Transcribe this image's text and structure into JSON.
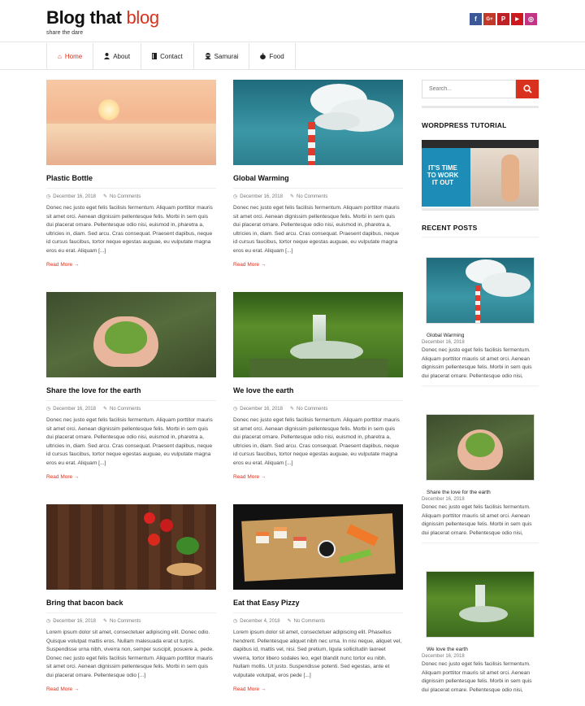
{
  "site": {
    "title_main": "Blog that",
    "title_accent": "blog",
    "tagline": "share the dare"
  },
  "socials": [
    {
      "name": "facebook",
      "glyph": "f",
      "color": "#3b5998"
    },
    {
      "name": "google-plus",
      "glyph": "G+",
      "color": "#c0392b"
    },
    {
      "name": "pinterest",
      "glyph": "P",
      "color": "#bd2126"
    },
    {
      "name": "youtube",
      "glyph": "▶",
      "color": "#cc181e"
    },
    {
      "name": "instagram",
      "glyph": "◎",
      "color": "#c13584"
    }
  ],
  "nav": {
    "items": [
      {
        "label": "Home",
        "icon": "home-icon"
      },
      {
        "label": "About",
        "icon": "user-icon"
      },
      {
        "label": "Contact",
        "icon": "book-icon"
      },
      {
        "label": "Samurai",
        "icon": "ninja-icon"
      },
      {
        "label": "Food",
        "icon": "apple-icon"
      }
    ]
  },
  "posts": [
    {
      "title": "Plastic Bottle",
      "date": "December 16, 2018",
      "comments": "No Comments",
      "excerpt": "Donec nec justo eget felis facilisis fermentum. Aliquam porttitor mauris sit amet orci. Aenean dignissim pellentesque felis. Morbi in sem quis dui placerat ornare. Pellentesque odio nisi, euismod in, pharetra a, ultricies in, diam. Sed arcu. Cras consequat. Praesent dapibus, neque id cursus faucibus, tortor neque egestas auguae, eu vulputate magna eros eu erat. Aliquam [...]",
      "read_more": "Read More →"
    },
    {
      "title": "Global Warming",
      "date": "December 16, 2018",
      "comments": "No Comments",
      "excerpt": "Donec nec justo eget felis facilisis fermentum. Aliquam porttitor mauris sit amet orci. Aenean dignissim pellentesque felis. Morbi in sem quis dui placerat ornare. Pellentesque odio nisi, euismod in, pharetra a, ultricies in, diam. Sed arcu. Cras consequat. Praesent dapibus, neque id cursus faucibus, tortor neque egestas auguae, eu vulputate magna eros eu erat. Aliquam [...]",
      "read_more": "Read More →"
    },
    {
      "title": "Share the love for the earth",
      "date": "December 16, 2018",
      "comments": "No Comments",
      "excerpt": "Donec nec justo eget felis facilisis fermentum. Aliquam porttitor mauris sit amet orci. Aenean dignissim pellentesque felis. Morbi in sem quis dui placerat ornare. Pellentesque odio nisi, euismod in, pharetra a, ultricies in, diam. Sed arcu. Cras consequat. Praesent dapibus, neque id cursus faucibus, tortor neque egestas auguae, eu vulputate magna eros eu erat. Aliquam [...]",
      "read_more": "Read More →"
    },
    {
      "title": "We love the earth",
      "date": "December 16, 2018",
      "comments": "No Comments",
      "excerpt": "Donec nec justo eget felis facilisis fermentum. Aliquam porttitor mauris sit amet orci. Aenean dignissim pellentesque felis. Morbi in sem quis dui placerat ornare. Pellentesque odio nisi, euismod in, pharetra a, ultricies in, diam. Sed arcu. Cras consequat. Praesent dapibus, neque id cursus faucibus, tortor neque egestas auguae, eu vulputate magna eros eu erat. Aliquam [...]",
      "read_more": "Read More →"
    },
    {
      "title": "Bring that bacon back",
      "date": "December 16, 2018",
      "comments": "No Comments",
      "excerpt": "Lorem ipsum dolor sit amet, consectetuer adipiscing elit. Donec odio. Quisque volutpat mattis eros. Nullam malesuada erat ut turpis. Suspendisse urna nibh, viverra non, semper suscipit, posuere a, pede. Donec nec justo eget felis facilisis fermentum. Aliquam porttitor mauris sit amet orci. Aenean dignissim pellentesque felis. Morbi in sem quis dui placerat ornare. Pellentesque odio [...]",
      "read_more": "Read More →"
    },
    {
      "title": "Eat that Easy Pizzy",
      "date": "December 4, 2018",
      "comments": "No Comments",
      "excerpt": "Lorem ipsum dolor sit amet, consectetuer adipiscing elit. Phasellus hendrerit. Pellentesque aliquet nibh nec urna. In nisi neque, aliquet vel, dapibus id, mattis vel, nisi. Sed pretium, ligula sollicitudin laoreet viverra, tortor libero sodales leo, eget blandit nunc tortor eu nibh. Nullam mollis. Ut justo. Suspendisse potenti. Sed egestas, ante et vulputate volutpat, eros pede [...]",
      "read_more": "Read More →"
    }
  ],
  "sidebar": {
    "search_placeholder": "Search...",
    "wp_title": "WORDPRESS TUTORIAL",
    "wp_thumb_text": "IT'S TIME TO WORK IT OUT",
    "recent_title": "RECENT POSTS",
    "recent": [
      {
        "title": "Global Warming",
        "date": "December 16, 2018",
        "excerpt": "Donec nec justo eget felis facilisis fermentum. Aliquam porttitor mauris sit amet orci. Aenean dignissim pellentesque felis. Morbi in sem quis dui placerat ornare. Pellentesque odio nisi, euismod in, pharetra ..."
      },
      {
        "title": "Share the love for the earth",
        "date": "December 16, 2018",
        "excerpt": "Donec nec justo eget felis facilisis fermentum. Aliquam porttitor mauris sit amet orci. Aenean dignissim pellentesque felis. Morbi in sem quis dui placerat ornare. Pellentesque odio nisi, euismod in, pharetra ..."
      },
      {
        "title": "We love the earth",
        "date": "December 16, 2018",
        "excerpt": "Donec nec justo eget felis facilisis fermentum. Aliquam porttitor mauris sit amet orci. Aenean dignissim pellentesque felis. Morbi in sem quis dui placerat ornare. Pellentesque odio nisi, euismod in, pharetra ..."
      }
    ]
  },
  "colors": {
    "accent": "#d8321e"
  }
}
